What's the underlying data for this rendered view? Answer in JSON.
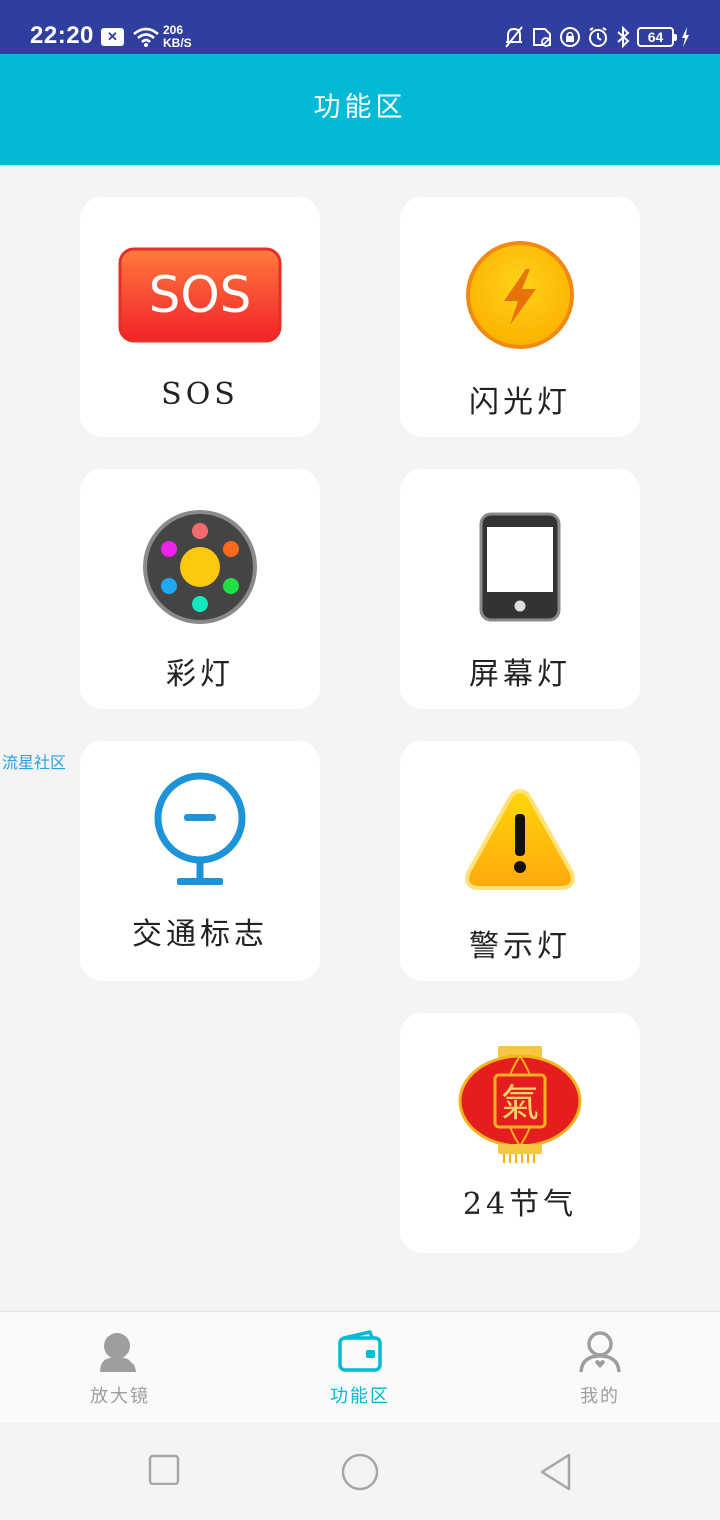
{
  "status_bar": {
    "time": "22:20",
    "notification_badge": "✕",
    "net_speed_value": "206",
    "net_speed_unit": "KB/S",
    "battery": "64",
    "icons": [
      "mute-icon",
      "sim-off-icon",
      "lock-rotation-icon",
      "alarm-icon",
      "bluetooth-icon",
      "battery-icon",
      "charging-icon"
    ]
  },
  "header": {
    "title": "功能区"
  },
  "side_link": {
    "label": "流星社区"
  },
  "cards": [
    {
      "label": "SOS",
      "icon": "sos-icon",
      "icon_text": "SOS"
    },
    {
      "label": "闪光灯",
      "icon": "flashlight-icon"
    },
    {
      "label": "彩灯",
      "icon": "color-light-icon"
    },
    {
      "label": "屏幕灯",
      "icon": "screen-light-icon"
    },
    {
      "label": "交通标志",
      "icon": "traffic-sign-icon"
    },
    {
      "label": "警示灯",
      "icon": "warning-light-icon"
    },
    {
      "label": "24节气",
      "icon": "solar-terms-lantern-icon",
      "icon_text": "氣"
    }
  ],
  "tabs": [
    {
      "label": "放大镜",
      "icon": "magnifier-user-icon",
      "active": false
    },
    {
      "label": "功能区",
      "icon": "wallet-icon",
      "active": true
    },
    {
      "label": "我的",
      "icon": "profile-icon",
      "active": false
    }
  ],
  "colors": {
    "status_bar": "#303e9f",
    "accent": "#02bad6",
    "tab_inactive": "#9e9e9e",
    "side_link": "#2aa0e0"
  }
}
